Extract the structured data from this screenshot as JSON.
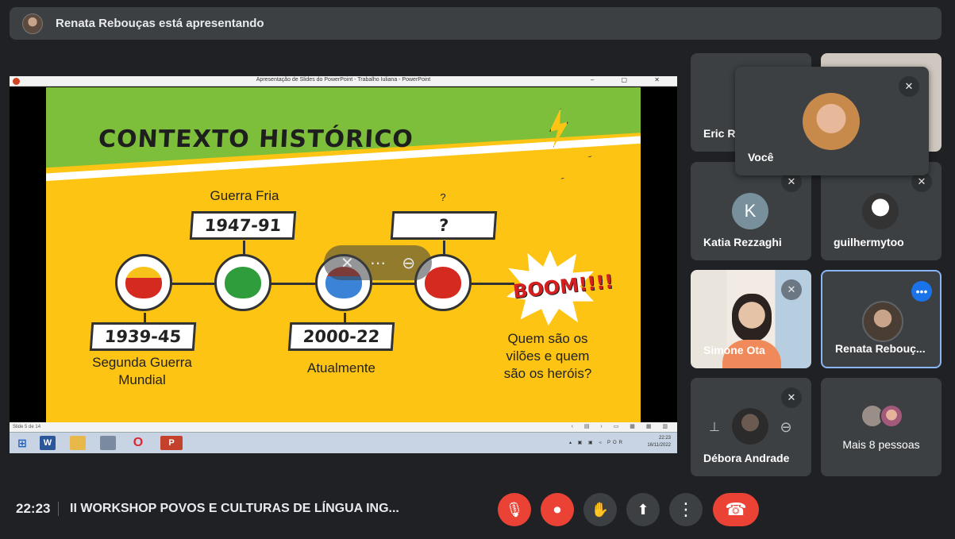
{
  "presenting": {
    "text": "Renata Rebouças está apresentando"
  },
  "ppt": {
    "window_title": "Apresentação de Slides do PowerPoint - Trabalho Iuliana - PowerPoint",
    "window_controls": "– ▢ ✕",
    "status_left": "Slide 5 de 14",
    "status_right": "‹ ▤ › ▭ ▦ ▦ ▥",
    "tray_lang": "POR",
    "tray_time": "22:23",
    "tray_date": "16/11/2022"
  },
  "slide": {
    "title": "CONTEXTO HISTÓRICO",
    "top_label_1": "Guerra Fria",
    "top_label_2": "?",
    "date_1": "1947-91",
    "date_2": "?",
    "date_3": "1939-45",
    "date_4": "2000-22",
    "bottom_label_1": "Segunda Guerra\nMundial",
    "bottom_label_2": "Atualmente",
    "boom": "BOOM!!!!",
    "question": "Quem são os\nvilões e quem\nsão os heróis?"
  },
  "participants": [
    {
      "name": "Eric R",
      "muted": false
    },
    {
      "name": "Você",
      "muted": true
    },
    {
      "name": "Katia Rezzaghi",
      "initial": "K",
      "muted": true
    },
    {
      "name": "guilhermytoo",
      "muted": true
    },
    {
      "name": "Simone Ota",
      "muted": true
    },
    {
      "name": "Renata Rebouç...",
      "muted": false
    },
    {
      "name": "Débora Andrade",
      "muted": true
    },
    {
      "name": "Mais 8 pessoas"
    }
  ],
  "bottom": {
    "time": "22:23",
    "meeting_title": "II WORKSHOP POVOS E CULTURAS DE LÍNGUA ING...",
    "mic_icon": "🎙",
    "cam_icon": "⏺",
    "hand_icon": "✋",
    "present_icon": "⬆",
    "more_icon": "⋮",
    "end_icon": "☎"
  },
  "colors": {
    "accent_red": "#ea4335",
    "tile_bg": "#3c4043",
    "active_border": "#8ab4f8",
    "slide_yellow": "#fdc414",
    "slide_green": "#7dbf3b"
  }
}
